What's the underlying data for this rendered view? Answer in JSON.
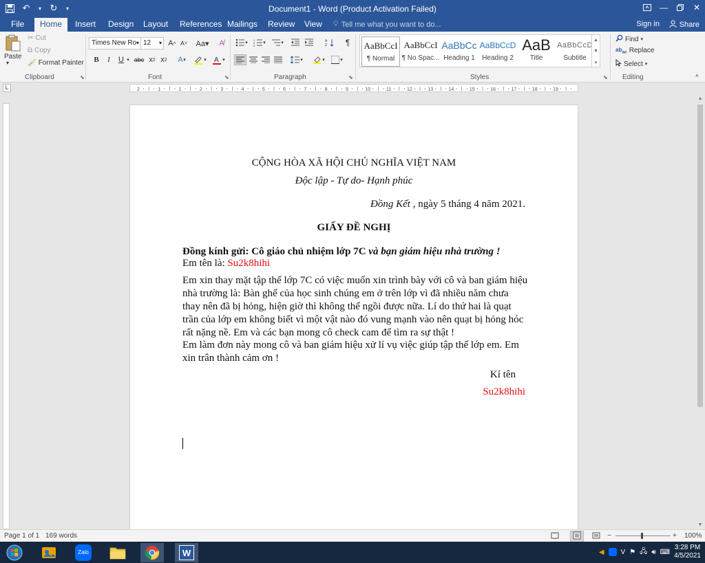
{
  "window": {
    "title": "Document1 - Word (Product Activation Failed)",
    "accent": "#2b579a"
  },
  "qat": {
    "save_icon": "save-icon",
    "undo_icon": "undo-icon",
    "redo_icon": "redo-icon"
  },
  "tabs": [
    {
      "label": "File"
    },
    {
      "label": "Home"
    },
    {
      "label": "Insert"
    },
    {
      "label": "Design"
    },
    {
      "label": "Layout"
    },
    {
      "label": "References"
    },
    {
      "label": "Mailings"
    },
    {
      "label": "Review"
    },
    {
      "label": "View"
    }
  ],
  "tellme": "Tell me what you want to do...",
  "account": {
    "signin": "Sign in",
    "share": "Share"
  },
  "clipboard": {
    "paste": "Paste",
    "cut": "Cut",
    "copy": "Copy",
    "format_painter": "Format Painter",
    "group": "Clipboard"
  },
  "font": {
    "name": "Times New Ro",
    "size": "12",
    "group": "Font"
  },
  "paragraph": {
    "group": "Paragraph"
  },
  "styles": {
    "group": "Styles",
    "items": [
      {
        "sample": "AaBbCcI",
        "name": "¶ Normal"
      },
      {
        "sample": "AaBbCcI",
        "name": "¶ No Spac..."
      },
      {
        "sample": "AaBbCc",
        "name": "Heading 1"
      },
      {
        "sample": "AaBbCcD",
        "name": "Heading 2"
      },
      {
        "sample": "AaB",
        "name": "Title"
      },
      {
        "sample": "AaBbCcD",
        "name": "Subtitle"
      }
    ]
  },
  "editing": {
    "find": "Find",
    "replace": "Replace",
    "select": "Select",
    "group": "Editing"
  },
  "ruler": {
    "marks": [
      "2",
      "1",
      "1",
      "2",
      "3",
      "4",
      "5",
      "6",
      "7",
      "8",
      "9",
      "10",
      "11",
      "12",
      "13",
      "14",
      "15",
      "16",
      "17",
      "18",
      "19"
    ]
  },
  "document": {
    "header_line1": "CỘNG HÒA XÃ HỘI CHỦ NGHĨA VIỆT NAM",
    "header_line2": "Độc lập - Tự do- Hạnh phúc",
    "date_place": "Đồng Kết ,",
    "date_rest": " ngày 5 tháng 4 năm 2021.",
    "doc_title": "GIẤY ĐỀ NGHỊ",
    "recipient_bold": "Đồng kính gửi: Cô giáo chủ nhiệm lớp 7C",
    "recipient_italic": " và bạn giám hiệu nhà trường !",
    "name_label": "Em tên là: ",
    "name_value": "Su2k8hihi",
    "para1": "Em xin thay mặt tập thể lớp 7C có việc muốn xin trình bày với cô và ban giám hiệu nhà trường là: Bàn ghế của học sinh chúng em ở trên lớp vì đã nhiều năm chưa thay nên đã bị hỏng, hiện giờ thì không thể ngồi được nữa. Lí do thứ hai là quạt trần của lớp em không biết vì một vật nào đó vung mạnh vào nên quạt bị hỏng hóc rất nặng nề. Em và các bạn mong cô check cam để tìm ra sự thật !",
    "para2": "Em làm đơn này mong cô và ban giám hiệu xử lí vụ việc giúp tập thể lớp em. Em xin trân thành cảm ơn !",
    "sign_label": "Kí tên",
    "sign_name": "Su2k8hihi",
    "highlight_color": "#e2100f"
  },
  "status": {
    "page": "Page 1 of 1",
    "words": "169 words",
    "zoom": "100%"
  },
  "taskbar": {
    "apps": [
      {
        "icon": "start-icon"
      },
      {
        "icon": "photo-app-icon"
      },
      {
        "icon": "zalo-icon",
        "label": "Zalo"
      },
      {
        "icon": "file-explorer-icon"
      },
      {
        "icon": "chrome-icon"
      },
      {
        "icon": "word-icon",
        "label": "W"
      }
    ],
    "lang": "V",
    "time": "3:28 PM",
    "date": "4/5/2021"
  }
}
